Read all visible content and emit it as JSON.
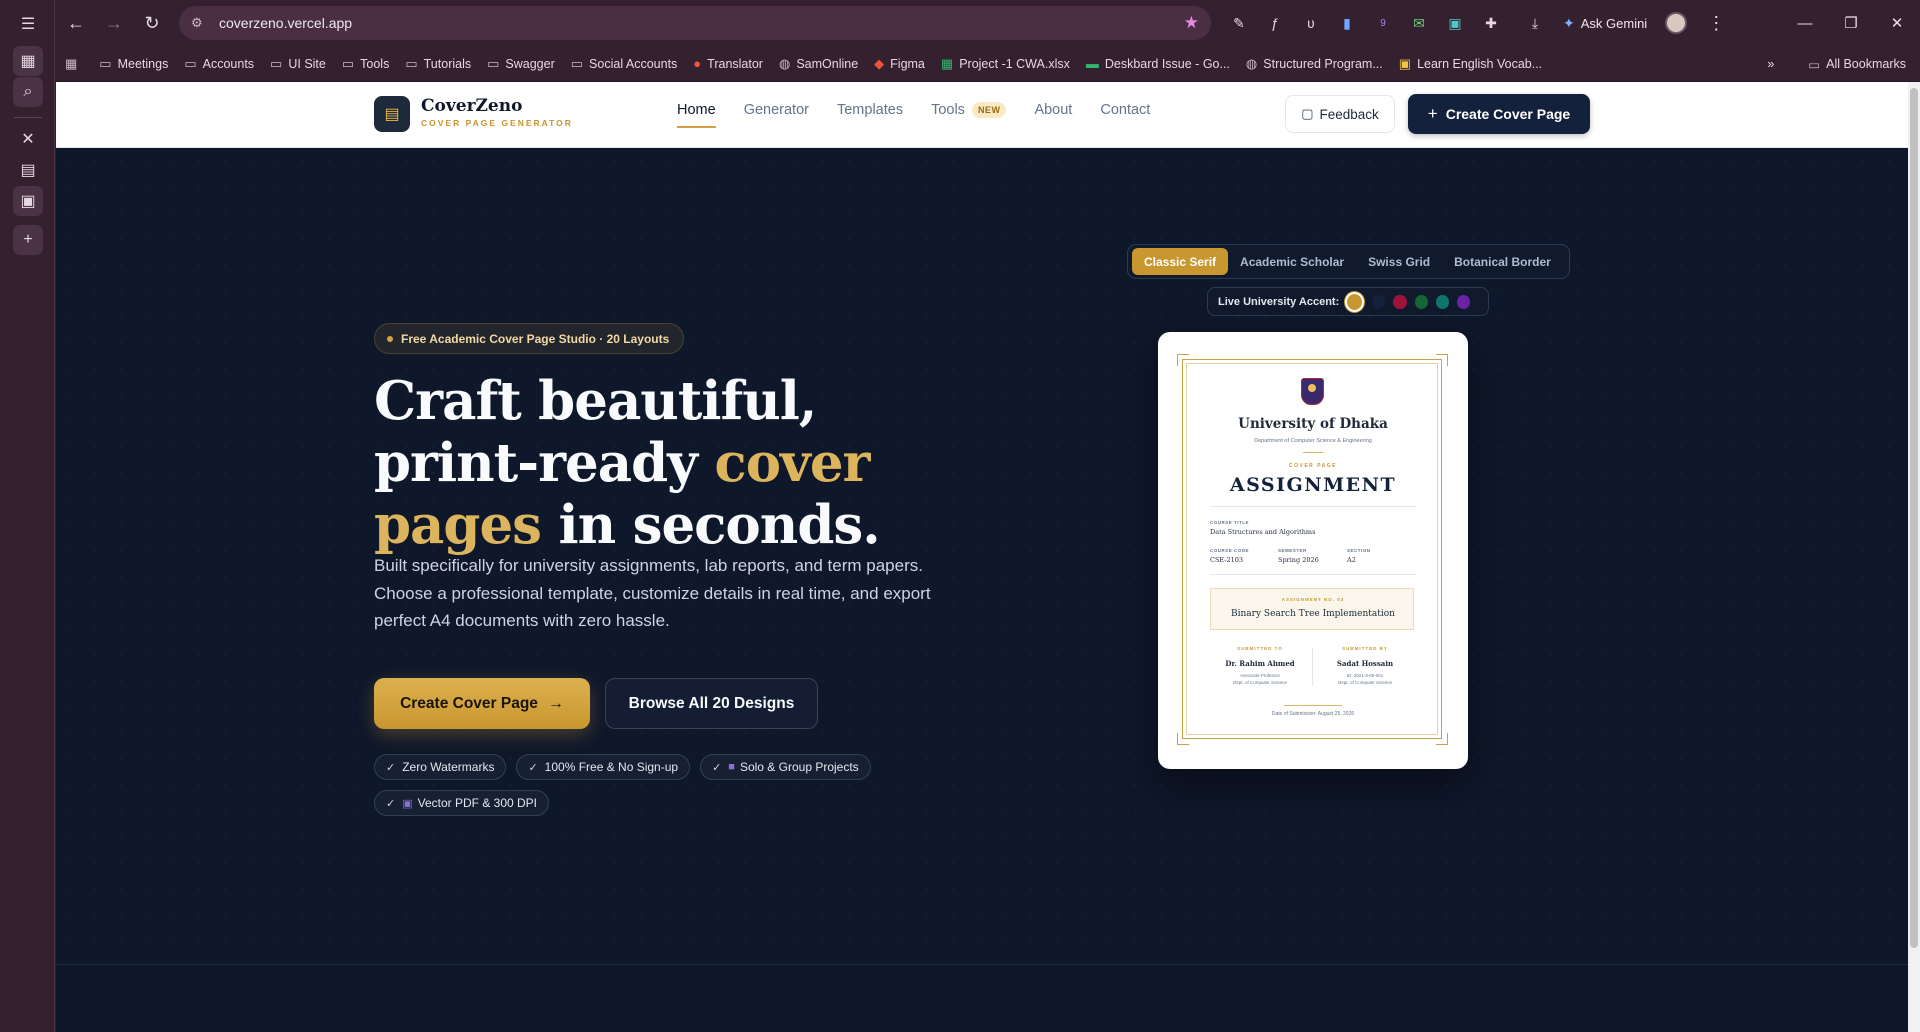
{
  "browser": {
    "url": "coverzeno.vercel.app",
    "ask_gemini": "Ask Gemini",
    "ext_badge": "9",
    "bookmarks": [
      {
        "label": "Meetings",
        "icon": "folder-icon"
      },
      {
        "label": "Accounts",
        "icon": "folder-icon"
      },
      {
        "label": "UI Site",
        "icon": "folder-icon"
      },
      {
        "label": "Tools",
        "icon": "folder-icon"
      },
      {
        "label": "Tutorials",
        "icon": "folder-icon"
      },
      {
        "label": "Swagger",
        "icon": "folder-icon"
      },
      {
        "label": "Social Accounts",
        "icon": "folder-icon"
      },
      {
        "label": "Translator",
        "icon": "google-translate-icon"
      },
      {
        "label": "SamOnline",
        "icon": "globe-icon"
      },
      {
        "label": "Figma",
        "icon": "figma-icon"
      },
      {
        "label": "Project -1 CWA.xlsx",
        "icon": "sheets-icon"
      },
      {
        "label": "Deskbard Issue - Go...",
        "icon": "sheets-icon"
      },
      {
        "label": "Structured Program...",
        "icon": "globe-icon"
      },
      {
        "label": "Learn English Vocab...",
        "icon": "site-icon"
      }
    ],
    "all_bookmarks": "All Bookmarks"
  },
  "site": {
    "brand_name": "CoverZeno",
    "brand_tagline": "COVER PAGE GENERATOR",
    "nav": [
      {
        "label": "Home"
      },
      {
        "label": "Generator"
      },
      {
        "label": "Templates"
      },
      {
        "label": "Tools",
        "badge": "NEW"
      },
      {
        "label": "About"
      },
      {
        "label": "Contact"
      }
    ],
    "feedback_label": "Feedback",
    "create_label": "Create Cover Page"
  },
  "hero": {
    "pill": "Free Academic Cover Page Studio · 20 Layouts",
    "headline_1": "Craft beautiful, print-ready ",
    "headline_gold": "cover pages",
    "headline_2": " in seconds.",
    "subtext": "Built specifically for university assignments, lab reports, and term papers. Choose a professional template, customize details in real time, and export perfect A4 documents with zero hassle.",
    "primary_cta": "Create Cover Page",
    "secondary_cta": "Browse All 20 Designs",
    "chips": [
      {
        "label": "Zero Watermarks"
      },
      {
        "label": "100% Free & No Sign-up"
      },
      {
        "label": "Solo & Group Projects"
      },
      {
        "label": "Vector PDF & 300 DPI"
      }
    ]
  },
  "preview": {
    "templates": [
      "Classic Serif",
      "Academic Scholar",
      "Swiss Grid",
      "Botanical Border"
    ],
    "active_template": "Classic Serif",
    "accent_label": "Live University Accent:",
    "accent_colors": [
      "#c9972f",
      "#14213d",
      "#9f1239",
      "#166534",
      "#0f766e",
      "#6b21a8"
    ],
    "doc": {
      "university": "University of Dhaka",
      "department": "Department of Computer Science & Engineering",
      "kicker": "COVER PAGE",
      "title": "ASSIGNMENT",
      "course_title_label": "COURSE TITLE",
      "course_title": "Data Structures and Algorithms",
      "course_code_label": "COURSE CODE",
      "course_code": "CSE-2103",
      "semester_label": "SEMESTER",
      "semester": "Spring 2026",
      "section_label": "SECTION",
      "section": "A2",
      "assignment_label": "ASSIGNMENT NO. 03",
      "assignment_title": "Binary Search Tree Implementation",
      "submitted_to_label": "SUBMITTED TO",
      "submitted_to_name": "Dr. Rahim Ahmed",
      "submitted_to_role": "Associate Professor",
      "submitted_to_dept": "Dept. of Computer Science",
      "submitted_by_label": "SUBMITTED BY",
      "submitted_by_name": "Sadat Hossain",
      "submitted_by_id": "ID: 2021-3-60-001",
      "submitted_by_dept": "Dept. of Computer Science",
      "date": "Date of Submission: August 25, 2026"
    }
  }
}
